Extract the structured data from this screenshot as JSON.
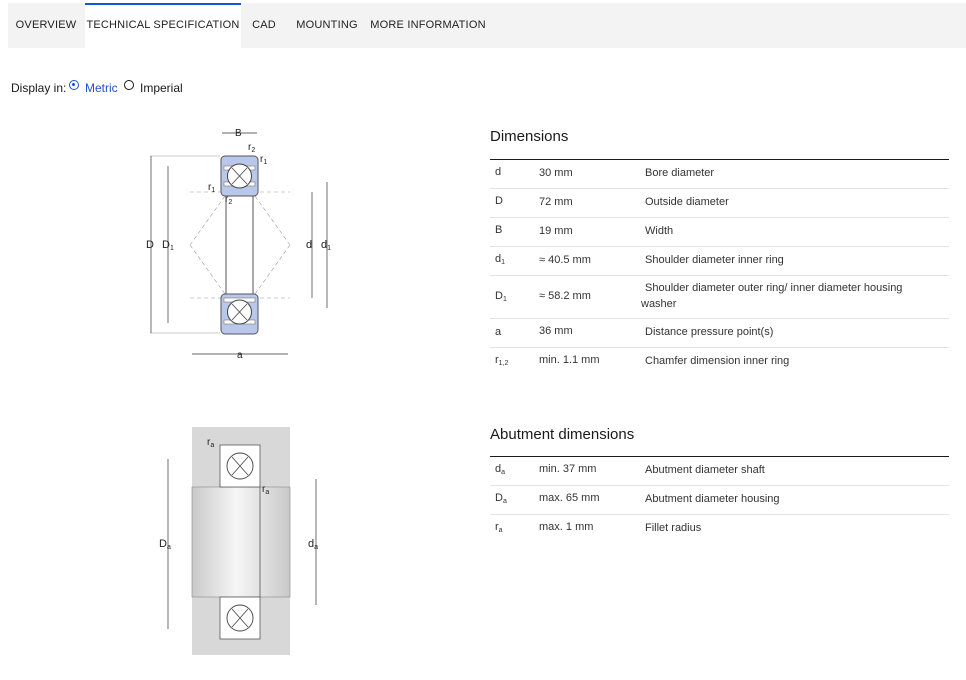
{
  "tabs": [
    {
      "label": "OVERVIEW",
      "active": false
    },
    {
      "label": "TECHNICAL SPECIFICATION",
      "active": true
    },
    {
      "label": "CAD",
      "active": false
    },
    {
      "label": "MOUNTING",
      "active": false
    },
    {
      "label": "MORE INFORMATION",
      "active": false
    }
  ],
  "display": {
    "label": "Display in:",
    "options": [
      "Metric",
      "Imperial"
    ],
    "selected": "Metric"
  },
  "dimensions": {
    "title": "Dimensions",
    "rows": [
      {
        "symbol": "d",
        "symbol_sub": "",
        "value": "30 mm",
        "description": "Bore diameter"
      },
      {
        "symbol": "D",
        "symbol_sub": "",
        "value": "72 mm",
        "description": "Outside diameter"
      },
      {
        "symbol": "B",
        "symbol_sub": "",
        "value": "19 mm",
        "description": "Width"
      },
      {
        "symbol": "d",
        "symbol_sub": "1",
        "value": "≈ 40.5 mm",
        "description": "Shoulder diameter inner ring"
      },
      {
        "symbol": "D",
        "symbol_sub": "1",
        "value": "≈ 58.2 mm",
        "description": "Shoulder diameter outer ring/ inner diameter housing washer"
      },
      {
        "symbol": "a",
        "symbol_sub": "",
        "value": "36 mm",
        "description": "Distance pressure point(s)"
      },
      {
        "symbol": "r",
        "symbol_sub": "1,2",
        "value": "min. 1.1 mm",
        "description": "Chamfer dimension inner ring"
      }
    ]
  },
  "abutment": {
    "title": "Abutment dimensions",
    "rows": [
      {
        "symbol": "d",
        "symbol_sub": "a",
        "value": "min. 37 mm",
        "description": "Abutment diameter shaft"
      },
      {
        "symbol": "D",
        "symbol_sub": "a",
        "value": "max. 65 mm",
        "description": "Abutment diameter housing"
      },
      {
        "symbol": "r",
        "symbol_sub": "a",
        "value": "max. 1 mm",
        "description": "Fillet radius"
      }
    ]
  },
  "diagram_top": {
    "labels": {
      "B": "B",
      "r2_top": "r",
      "r2_top_sub": "2",
      "r1_top": "r",
      "r1_top_sub": "1",
      "r1_left": "r",
      "r1_left_sub": "1",
      "r2_left": "r",
      "r2_left_sub": "2",
      "D": "D",
      "D1": "D",
      "D1_sub": "1",
      "d": "d",
      "d1": "d",
      "d1_sub": "1",
      "a": "a"
    },
    "colors": {
      "ring": "#b9c7ea",
      "ring_stroke": "#555555",
      "dim": "#333333"
    }
  },
  "diagram_bottom": {
    "labels": {
      "ra_top": "r",
      "ra_top_sub": "a",
      "ra_mid": "r",
      "ra_mid_sub": "a",
      "Da": "D",
      "Da_sub": "a",
      "da": "d",
      "da_sub": "a"
    },
    "colors": {
      "housing": "#d8d8d8",
      "shaft_light": "#f4f4f4",
      "shaft_dark": "#c9c9c9"
    }
  }
}
